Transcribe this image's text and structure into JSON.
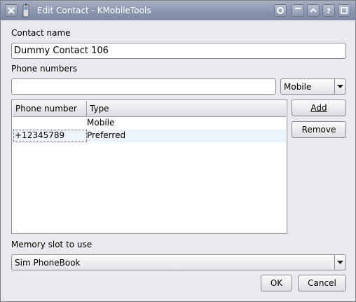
{
  "window": {
    "title": "Edit Contact - KMobileTools"
  },
  "form": {
    "contact_name_label": "Contact name",
    "contact_name_value": "Dummy Contact 106",
    "phone_numbers_label": "Phone numbers",
    "phone_number_input_value": "",
    "phone_type_selected": "Mobile",
    "memory_slot_label": "Memory slot to use",
    "memory_slot_selected": "Sim PhoneBook"
  },
  "phone_table": {
    "columns": [
      "Phone number",
      "Type"
    ],
    "rows": [
      {
        "number": "",
        "type": "Mobile"
      },
      {
        "number": "+12345789",
        "type": "Preferred"
      }
    ]
  },
  "buttons": {
    "add": "Add",
    "remove": "Remove",
    "ok": "OK",
    "cancel": "Cancel"
  },
  "colors": {
    "titlebar": "#8e99b2",
    "selected_row": "#eef4fb",
    "window_bg": "#ebe9ed"
  }
}
